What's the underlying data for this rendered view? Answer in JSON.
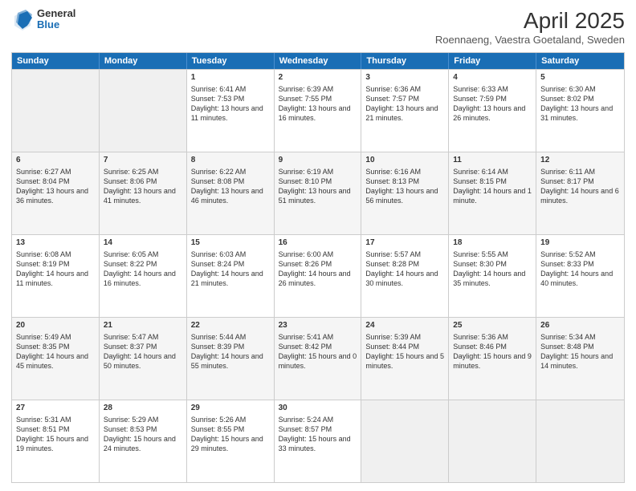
{
  "header": {
    "logo_general": "General",
    "logo_blue": "Blue",
    "month_title": "April 2025",
    "location": "Roennaeng, Vaestra Goetaland, Sweden"
  },
  "weekdays": [
    "Sunday",
    "Monday",
    "Tuesday",
    "Wednesday",
    "Thursday",
    "Friday",
    "Saturday"
  ],
  "rows": [
    [
      {
        "day": "",
        "info": ""
      },
      {
        "day": "",
        "info": ""
      },
      {
        "day": "1",
        "info": "Sunrise: 6:41 AM\nSunset: 7:53 PM\nDaylight: 13 hours and 11 minutes."
      },
      {
        "day": "2",
        "info": "Sunrise: 6:39 AM\nSunset: 7:55 PM\nDaylight: 13 hours and 16 minutes."
      },
      {
        "day": "3",
        "info": "Sunrise: 6:36 AM\nSunset: 7:57 PM\nDaylight: 13 hours and 21 minutes."
      },
      {
        "day": "4",
        "info": "Sunrise: 6:33 AM\nSunset: 7:59 PM\nDaylight: 13 hours and 26 minutes."
      },
      {
        "day": "5",
        "info": "Sunrise: 6:30 AM\nSunset: 8:02 PM\nDaylight: 13 hours and 31 minutes."
      }
    ],
    [
      {
        "day": "6",
        "info": "Sunrise: 6:27 AM\nSunset: 8:04 PM\nDaylight: 13 hours and 36 minutes."
      },
      {
        "day": "7",
        "info": "Sunrise: 6:25 AM\nSunset: 8:06 PM\nDaylight: 13 hours and 41 minutes."
      },
      {
        "day": "8",
        "info": "Sunrise: 6:22 AM\nSunset: 8:08 PM\nDaylight: 13 hours and 46 minutes."
      },
      {
        "day": "9",
        "info": "Sunrise: 6:19 AM\nSunset: 8:10 PM\nDaylight: 13 hours and 51 minutes."
      },
      {
        "day": "10",
        "info": "Sunrise: 6:16 AM\nSunset: 8:13 PM\nDaylight: 13 hours and 56 minutes."
      },
      {
        "day": "11",
        "info": "Sunrise: 6:14 AM\nSunset: 8:15 PM\nDaylight: 14 hours and 1 minute."
      },
      {
        "day": "12",
        "info": "Sunrise: 6:11 AM\nSunset: 8:17 PM\nDaylight: 14 hours and 6 minutes."
      }
    ],
    [
      {
        "day": "13",
        "info": "Sunrise: 6:08 AM\nSunset: 8:19 PM\nDaylight: 14 hours and 11 minutes."
      },
      {
        "day": "14",
        "info": "Sunrise: 6:05 AM\nSunset: 8:22 PM\nDaylight: 14 hours and 16 minutes."
      },
      {
        "day": "15",
        "info": "Sunrise: 6:03 AM\nSunset: 8:24 PM\nDaylight: 14 hours and 21 minutes."
      },
      {
        "day": "16",
        "info": "Sunrise: 6:00 AM\nSunset: 8:26 PM\nDaylight: 14 hours and 26 minutes."
      },
      {
        "day": "17",
        "info": "Sunrise: 5:57 AM\nSunset: 8:28 PM\nDaylight: 14 hours and 30 minutes."
      },
      {
        "day": "18",
        "info": "Sunrise: 5:55 AM\nSunset: 8:30 PM\nDaylight: 14 hours and 35 minutes."
      },
      {
        "day": "19",
        "info": "Sunrise: 5:52 AM\nSunset: 8:33 PM\nDaylight: 14 hours and 40 minutes."
      }
    ],
    [
      {
        "day": "20",
        "info": "Sunrise: 5:49 AM\nSunset: 8:35 PM\nDaylight: 14 hours and 45 minutes."
      },
      {
        "day": "21",
        "info": "Sunrise: 5:47 AM\nSunset: 8:37 PM\nDaylight: 14 hours and 50 minutes."
      },
      {
        "day": "22",
        "info": "Sunrise: 5:44 AM\nSunset: 8:39 PM\nDaylight: 14 hours and 55 minutes."
      },
      {
        "day": "23",
        "info": "Sunrise: 5:41 AM\nSunset: 8:42 PM\nDaylight: 15 hours and 0 minutes."
      },
      {
        "day": "24",
        "info": "Sunrise: 5:39 AM\nSunset: 8:44 PM\nDaylight: 15 hours and 5 minutes."
      },
      {
        "day": "25",
        "info": "Sunrise: 5:36 AM\nSunset: 8:46 PM\nDaylight: 15 hours and 9 minutes."
      },
      {
        "day": "26",
        "info": "Sunrise: 5:34 AM\nSunset: 8:48 PM\nDaylight: 15 hours and 14 minutes."
      }
    ],
    [
      {
        "day": "27",
        "info": "Sunrise: 5:31 AM\nSunset: 8:51 PM\nDaylight: 15 hours and 19 minutes."
      },
      {
        "day": "28",
        "info": "Sunrise: 5:29 AM\nSunset: 8:53 PM\nDaylight: 15 hours and 24 minutes."
      },
      {
        "day": "29",
        "info": "Sunrise: 5:26 AM\nSunset: 8:55 PM\nDaylight: 15 hours and 29 minutes."
      },
      {
        "day": "30",
        "info": "Sunrise: 5:24 AM\nSunset: 8:57 PM\nDaylight: 15 hours and 33 minutes."
      },
      {
        "day": "",
        "info": ""
      },
      {
        "day": "",
        "info": ""
      },
      {
        "day": "",
        "info": ""
      }
    ]
  ]
}
